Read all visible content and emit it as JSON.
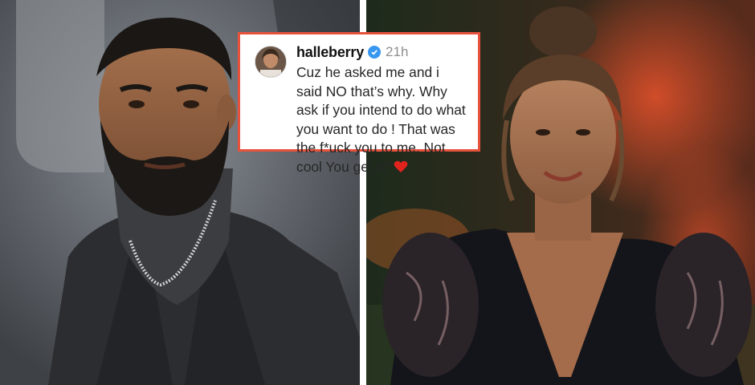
{
  "comment": {
    "username": "halleberry",
    "verified_icon": "verified-badge-icon",
    "timestamp": "21h",
    "text": "Cuz he asked me and i said NO that’s why. Why ask if you intend to do what you want to do ! That was the f*uck you to me. Not cool You get it?",
    "emoji_icon": "red-heart-icon",
    "colors": {
      "card_border": "#e8513c",
      "heart": "#e0231d",
      "verified": "#3897f0"
    }
  }
}
